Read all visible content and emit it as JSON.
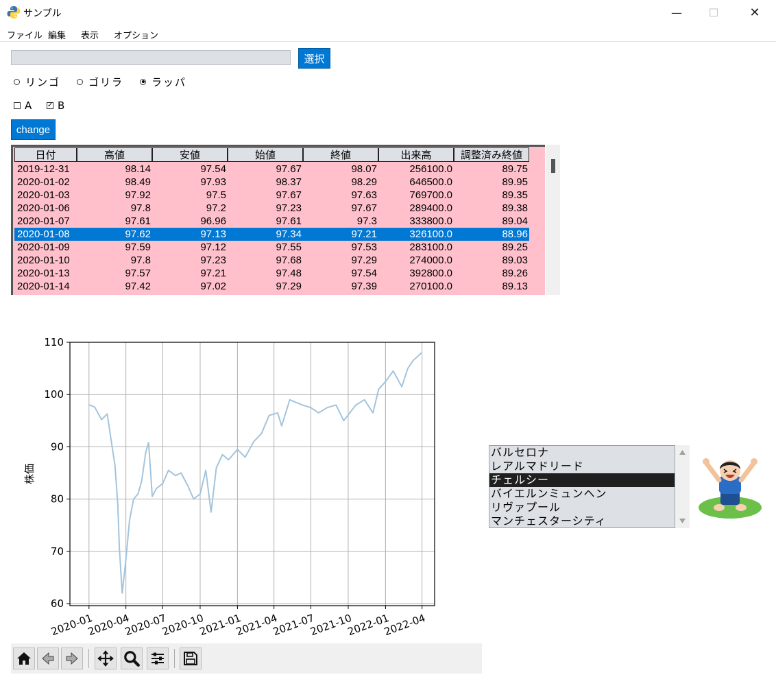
{
  "window": {
    "title": "サンプル",
    "minimize_glyph": "—",
    "maximize_glyph": "☐",
    "close_glyph": "✕"
  },
  "menu": [
    "ファイル",
    "編集",
    "表示",
    "オプション"
  ],
  "entry": {
    "value": ""
  },
  "select_button": "選択",
  "radios": [
    {
      "label": "リンゴ",
      "selected": false
    },
    {
      "label": "ゴリラ",
      "selected": false
    },
    {
      "label": "ラッパ",
      "selected": true
    }
  ],
  "checkboxes": [
    {
      "label": "A",
      "checked": false
    },
    {
      "label": "B",
      "checked": true
    }
  ],
  "change_button": "change",
  "table": {
    "columns": [
      "日付",
      "高値",
      "安値",
      "始値",
      "終値",
      "出来高",
      "調整済み終値"
    ],
    "rows": [
      [
        "2019-12-31",
        "98.14",
        "97.54",
        "97.67",
        "98.07",
        "256100.0",
        "89.75"
      ],
      [
        "2020-01-02",
        "98.49",
        "97.93",
        "98.37",
        "98.29",
        "646500.0",
        "89.95"
      ],
      [
        "2020-01-03",
        "97.92",
        "97.5",
        "97.67",
        "97.63",
        "769700.0",
        "89.35"
      ],
      [
        "2020-01-06",
        "97.8",
        "97.2",
        "97.23",
        "97.67",
        "289400.0",
        "89.38"
      ],
      [
        "2020-01-07",
        "97.61",
        "96.96",
        "97.61",
        "97.3",
        "333800.0",
        "89.04"
      ],
      [
        "2020-01-08",
        "97.62",
        "97.13",
        "97.34",
        "97.21",
        "326100.0",
        "88.96"
      ],
      [
        "2020-01-09",
        "97.59",
        "97.12",
        "97.55",
        "97.53",
        "283100.0",
        "89.25"
      ],
      [
        "2020-01-10",
        "97.8",
        "97.23",
        "97.68",
        "97.29",
        "274000.0",
        "89.03"
      ],
      [
        "2020-01-13",
        "97.57",
        "97.21",
        "97.48",
        "97.54",
        "392800.0",
        "89.26"
      ],
      [
        "2020-01-14",
        "97.42",
        "97.02",
        "97.29",
        "97.39",
        "270100.0",
        "89.13"
      ]
    ],
    "selected_row": 5,
    "row_color": "#ffc0cb",
    "selected_color": "#0078d4"
  },
  "chart_data": {
    "type": "line",
    "ylabel": "株価",
    "ylim": [
      60,
      110
    ],
    "yticks": [
      60,
      70,
      80,
      90,
      100,
      110
    ],
    "xticks": [
      "2020-01",
      "2020-04",
      "2020-07",
      "2020-10",
      "2021-01",
      "2021-04",
      "2021-07",
      "2021-10",
      "2022-01",
      "2022-04"
    ],
    "grid": true,
    "line_color": "#a3c4dc",
    "series": [
      {
        "x": [
          "2019-12-31",
          "2020-01-15",
          "2020-02-01",
          "2020-02-15",
          "2020-02-25",
          "2020-03-05",
          "2020-03-12",
          "2020-03-16",
          "2020-03-23",
          "2020-04-01",
          "2020-04-10",
          "2020-04-20",
          "2020-05-01",
          "2020-05-10",
          "2020-05-20",
          "2020-05-27",
          "2020-06-05",
          "2020-06-15",
          "2020-07-01",
          "2020-07-15",
          "2020-08-01",
          "2020-08-15",
          "2020-09-01",
          "2020-09-15",
          "2020-10-01",
          "2020-10-15",
          "2020-10-28",
          "2020-11-10",
          "2020-11-25",
          "2020-12-10",
          "2021-01-01",
          "2021-01-20",
          "2021-02-10",
          "2021-03-01",
          "2021-03-20",
          "2021-04-10",
          "2021-04-20",
          "2021-05-10",
          "2021-05-25",
          "2021-06-10",
          "2021-07-01",
          "2021-07-20",
          "2021-08-10",
          "2021-09-01",
          "2021-09-20",
          "2021-10-05",
          "2021-10-20",
          "2021-11-10",
          "2021-12-01",
          "2021-12-15",
          "2022-01-01",
          "2022-01-20",
          "2022-02-10",
          "2022-02-25",
          "2022-03-10",
          "2022-03-31"
        ],
        "y": [
          98.1,
          97.6,
          95.2,
          96.3,
          91.0,
          86.5,
          79.0,
          70.5,
          62.0,
          68.5,
          76.0,
          80.0,
          81.0,
          83.5,
          89.0,
          90.8,
          80.5,
          82.0,
          83.0,
          85.5,
          84.5,
          85.0,
          82.5,
          80.0,
          81.0,
          85.5,
          77.5,
          86.0,
          88.5,
          87.5,
          89.5,
          88.0,
          91.0,
          92.5,
          96.0,
          96.5,
          94.0,
          99.0,
          98.5,
          98.0,
          97.5,
          96.5,
          97.5,
          98.0,
          95.0,
          96.5,
          98.0,
          99.0,
          96.5,
          101.0,
          102.5,
          104.5,
          101.5,
          105.0,
          106.5,
          108.0
        ]
      }
    ]
  },
  "toolbar": {
    "buttons": [
      "home",
      "back",
      "forward",
      "pan",
      "zoom",
      "configure",
      "save"
    ]
  },
  "listbox": {
    "items": [
      "バルセロナ",
      "レアルマドリード",
      "チェルシー",
      "バイエルンミュンヘン",
      "リヴァプール",
      "マンチェスターシティ"
    ],
    "selected": 2
  }
}
